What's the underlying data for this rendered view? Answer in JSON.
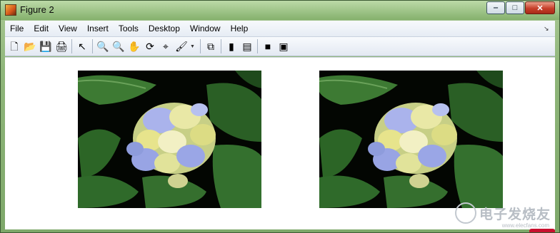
{
  "window": {
    "title": "Figure 2",
    "controls": {
      "minimize": "‒",
      "maximize": "□",
      "close": "✕"
    }
  },
  "menu": {
    "items": [
      "File",
      "Edit",
      "View",
      "Insert",
      "Tools",
      "Desktop",
      "Window",
      "Help"
    ],
    "overflow_glyph": "↘"
  },
  "toolbar": {
    "icons": [
      {
        "name": "new-figure-icon",
        "glyph": "🗋"
      },
      {
        "name": "open-file-icon",
        "glyph": "📂"
      },
      {
        "name": "save-figure-icon",
        "glyph": "💾"
      },
      {
        "name": "print-figure-icon",
        "glyph": "🖨"
      },
      {
        "name": "edit-plot-arrow-icon",
        "glyph": "↖"
      },
      {
        "name": "zoom-in-icon",
        "glyph": "🔍"
      },
      {
        "name": "zoom-out-icon",
        "glyph": "🔍"
      },
      {
        "name": "pan-hand-icon",
        "glyph": "✋"
      },
      {
        "name": "rotate-3d-icon",
        "glyph": "⟳"
      },
      {
        "name": "data-cursor-icon",
        "glyph": "⌖"
      },
      {
        "name": "brush-icon",
        "glyph": "🖌"
      },
      {
        "name": "link-plot-icon",
        "glyph": "⧉"
      },
      {
        "name": "insert-colorbar-icon",
        "glyph": "▮"
      },
      {
        "name": "insert-legend-icon",
        "glyph": "▤"
      },
      {
        "name": "hide-plot-tools-icon",
        "glyph": "■"
      },
      {
        "name": "show-plot-tools-icon",
        "glyph": "▣"
      }
    ]
  },
  "figure": {
    "axes": [
      {
        "name": "left-image-axes",
        "content": "hydrangea-image"
      },
      {
        "name": "right-image-axes",
        "content": "hydrangea-image"
      }
    ]
  },
  "watermark": {
    "text": "电子发烧友",
    "subtext": "www.elecfans.com"
  },
  "colors": {
    "title_bar": "#8fb67a",
    "menu_bar": "#eef2f8",
    "canvas": "#ffffff",
    "image_bg": "#030602",
    "leaf": "#2f6a2a",
    "flower_blue": "#9aa6e6",
    "flower_yellow": "#e7e48c",
    "close_button": "#c7402a"
  }
}
